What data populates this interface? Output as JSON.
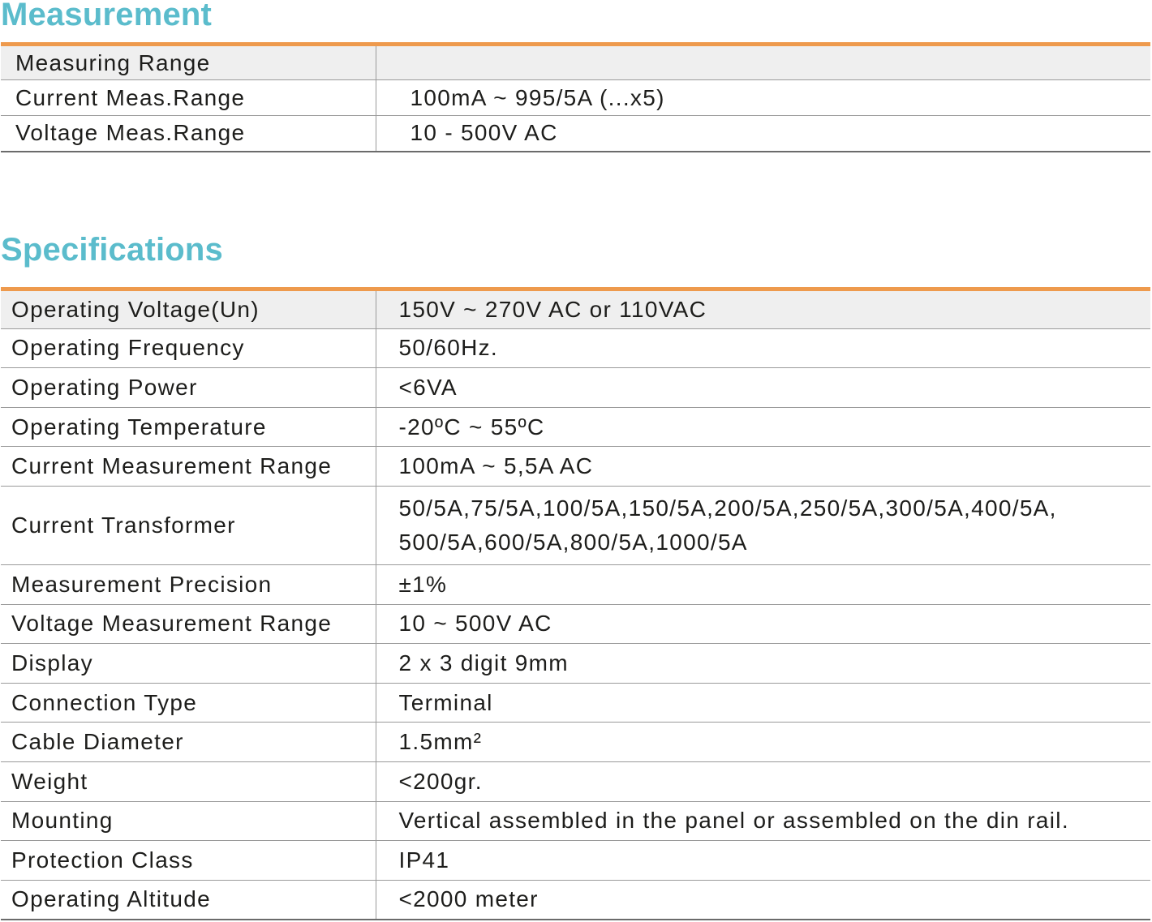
{
  "measurement": {
    "title": "Measurement",
    "rows": [
      {
        "label": "Measuring Range",
        "value": ""
      },
      {
        "label": "Current Meas.Range",
        "value": "100mA ~ 995/5A (...x5)"
      },
      {
        "label": "Voltage Meas.Range",
        "value": "10 - 500V AC"
      }
    ]
  },
  "specifications": {
    "title": "Specifications",
    "rows": [
      {
        "label": "Operating Voltage(Un)",
        "value": "150V ~ 270V AC or 110VAC"
      },
      {
        "label": "Operating Frequency",
        "value": "50/60Hz."
      },
      {
        "label": "Operating Power",
        "value": "<6VA"
      },
      {
        "label": "Operating Temperature",
        "value": "-20ºC ~ 55ºC"
      },
      {
        "label": "Current Measurement Range",
        "value": "100mA ~ 5,5A AC"
      },
      {
        "label": "Current Transformer",
        "value": "50/5A,75/5A,100/5A,150/5A,200/5A,250/5A,300/5A,400/5A, 500/5A,600/5A,800/5A,1000/5A"
      },
      {
        "label": "Measurement Precision",
        "value": "±1%"
      },
      {
        "label": "Voltage Measurement Range",
        "value": "10 ~ 500V AC"
      },
      {
        "label": "Display",
        "value": "2 x 3 digit 9mm"
      },
      {
        "label": "Connection Type",
        "value": "Terminal"
      },
      {
        "label": "Cable Diameter",
        "value": "1.5mm²"
      },
      {
        "label": "Weight",
        "value": "<200gr."
      },
      {
        "label": "Mounting",
        "value": "Vertical assembled in the panel or assembled on the din rail."
      },
      {
        "label": "Protection Class",
        "value": "IP41"
      },
      {
        "label": "Operating Altitude",
        "value": "<2000 meter"
      }
    ]
  }
}
